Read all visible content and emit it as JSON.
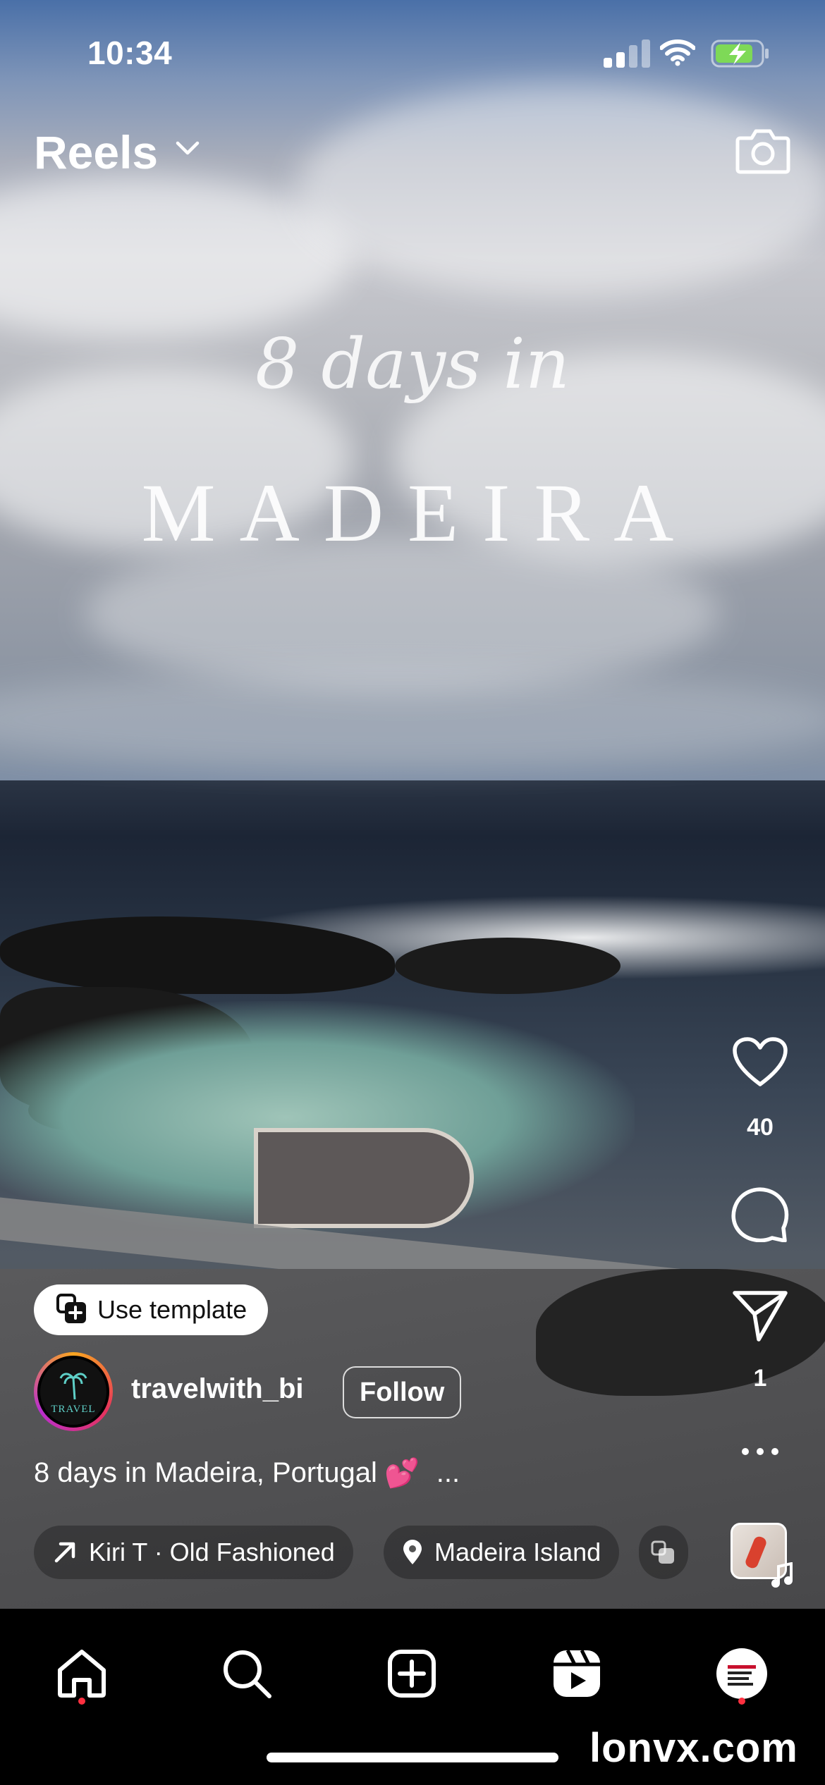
{
  "status_bar": {
    "time": "10:34"
  },
  "header": {
    "title": "Reels"
  },
  "video_overlay": {
    "line1": "8 days in",
    "line2": "MADEIRA"
  },
  "actions": {
    "likes": "40",
    "shares": "1"
  },
  "template_button": {
    "label": "Use template"
  },
  "author": {
    "username": "travelwith_bi",
    "avatar_text": "TRAVEL",
    "follow_label": "Follow"
  },
  "caption": {
    "text": "8 days in Madeira, Portugal",
    "emoji": "💕",
    "more": "..."
  },
  "audio": {
    "label": "Kiri T · Old Fashioned"
  },
  "location": {
    "label": "Madeira Island"
  },
  "watermark": "lonvx.com",
  "colors": {
    "notification_dot": "#ff3040",
    "battery": "#7ed957"
  }
}
